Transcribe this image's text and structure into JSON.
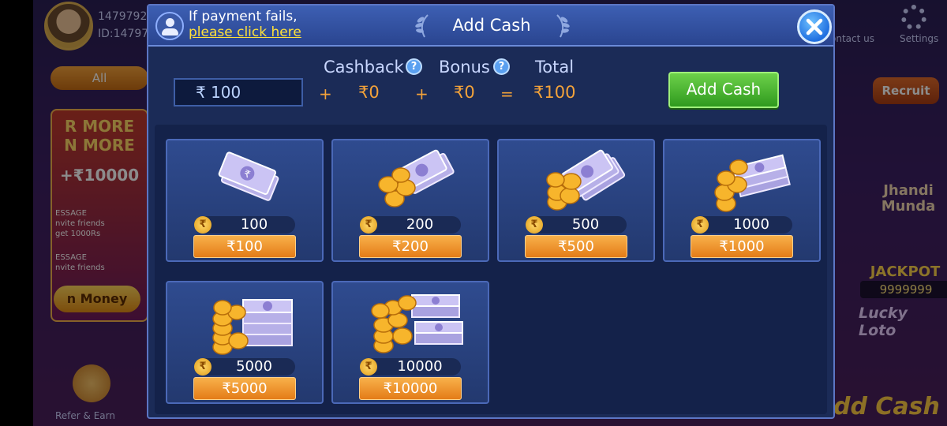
{
  "background": {
    "user_id_top": "1479792",
    "user_id": "ID:14797",
    "all_label": "All",
    "promo_line1": "R MORE",
    "promo_line2": "N MORE",
    "promo_amount": "+₹10000",
    "promo_msg1": "ESSAGE\nnvite friends\nget 1000Rs",
    "promo_msg2": "ESSAGE\nnvite friends",
    "promo_button": "n Money",
    "refer_label": "Refer & Earn",
    "contact_label": "ontact us",
    "settings_label": "Settings",
    "recruit_label": "Recruit",
    "jhandi_label": "Jhandi\nMunda",
    "jackpot_label": "JACKPOT",
    "jackpot_value": "9999999",
    "lucky_label": "Lucky Loto",
    "addcash_label": "dd Cash"
  },
  "modal": {
    "title": "Add Cash",
    "payment_fail_text": "If payment fails,",
    "payment_fail_link": "please click here",
    "summary": {
      "cashback_label": "Cashback",
      "bonus_label": "Bonus",
      "total_label": "Total",
      "amount_value": "₹ 100",
      "plus": "+",
      "equals": "=",
      "cashback_value": "₹0",
      "bonus_value": "₹0",
      "total_value": "₹100",
      "help_glyph": "?"
    },
    "add_cash_button": "Add Cash",
    "packages": [
      {
        "amount": "100",
        "button": "₹100",
        "art": "notes-small"
      },
      {
        "amount": "200",
        "button": "₹200",
        "art": "notes-coins"
      },
      {
        "amount": "500",
        "button": "₹500",
        "art": "notes-coins-more"
      },
      {
        "amount": "1000",
        "button": "₹1000",
        "art": "stack-coins"
      },
      {
        "amount": "5000",
        "button": "₹5000",
        "art": "big-stack-coins"
      },
      {
        "amount": "10000",
        "button": "₹10000",
        "art": "huge-stack-coins"
      }
    ],
    "coin_glyph": "₹"
  },
  "colors": {
    "accent_orange": "#f3a23a",
    "link_yellow": "#ffe13a",
    "add_cash_green": "#4cb832",
    "panel_blue": "#1b2b57"
  }
}
